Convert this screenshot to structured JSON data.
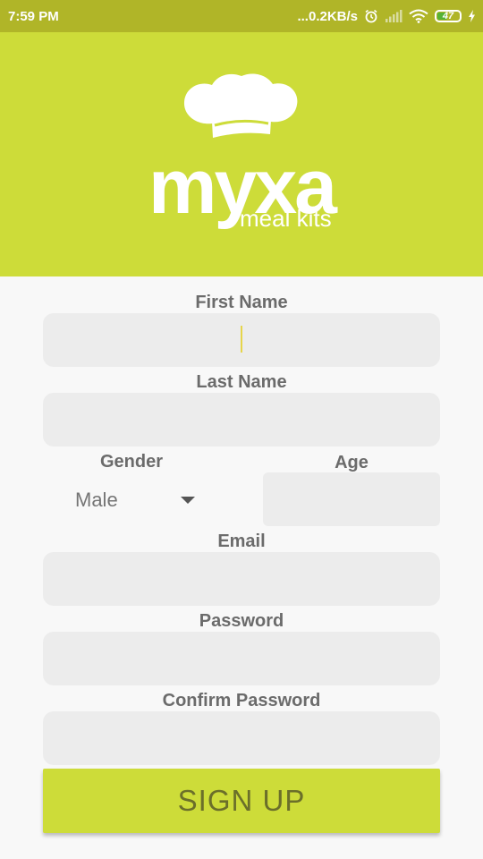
{
  "status_bar": {
    "time": "7:59 PM",
    "network_speed": "...0.2KB/s",
    "battery_level": "47",
    "battery_fill_fraction": 0.47,
    "icons": [
      "alarm-icon",
      "signal-icon",
      "wifi-icon",
      "battery-icon",
      "charging-icon"
    ]
  },
  "header": {
    "brand_color": "#cddc39",
    "logo_icon": "chef-hat-icon",
    "logo_word": "myxa",
    "logo_tagline": "meal kits"
  },
  "form": {
    "first_name": {
      "label": "First Name",
      "value": ""
    },
    "last_name": {
      "label": "Last Name",
      "value": ""
    },
    "gender": {
      "label": "Gender",
      "value": "Male"
    },
    "age": {
      "label": "Age",
      "value": ""
    },
    "email": {
      "label": "Email",
      "value": ""
    },
    "password": {
      "label": "Password",
      "value": ""
    },
    "confirm_password": {
      "label": "Confirm Password",
      "value": ""
    },
    "signup_label": "SIGN UP",
    "field_color": "#ececec"
  }
}
